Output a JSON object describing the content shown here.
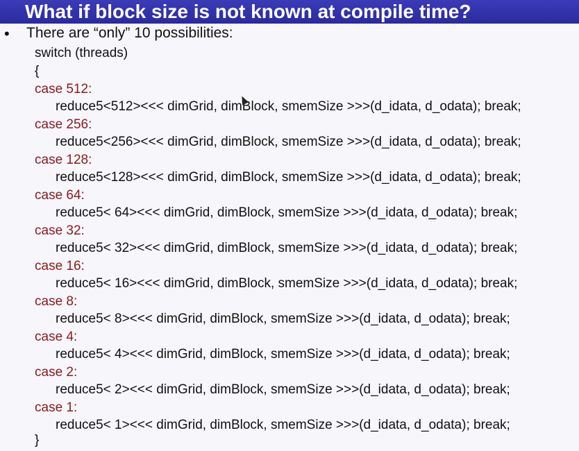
{
  "slide": {
    "title": "What if block size is not known at compile time?",
    "bullet_symbol": "•",
    "bullet_text": "There are “only” 10 possibilities:",
    "code": {
      "switch_line": "switch (threads)",
      "open_brace": "{",
      "close_brace": "}",
      "cases": [
        {
          "label": "case 512:",
          "call": "reduce5<512><<< dimGrid, dimBlock, smemSize >>>(d_idata, d_odata); break;"
        },
        {
          "label": "case 256:",
          "call": "reduce5<256><<< dimGrid, dimBlock, smemSize >>>(d_idata, d_odata); break;"
        },
        {
          "label": "case 128:",
          "call": "reduce5<128><<< dimGrid, dimBlock, smemSize >>>(d_idata, d_odata); break;"
        },
        {
          "label": "case 64:",
          "call": "reduce5< 64><<< dimGrid, dimBlock, smemSize >>>(d_idata, d_odata); break;"
        },
        {
          "label": "case 32:",
          "call": "reduce5< 32><<< dimGrid, dimBlock, smemSize >>>(d_idata, d_odata); break;"
        },
        {
          "label": "case 16:",
          "call": "reduce5< 16><<< dimGrid, dimBlock, smemSize >>>(d_idata, d_odata); break;"
        },
        {
          "label": "case 8:",
          "call": "reduce5< 8><<< dimGrid, dimBlock, smemSize >>>(d_idata, d_odata); break;"
        },
        {
          "label": "case 4:",
          "call": "reduce5< 4><<< dimGrid, dimBlock, smemSize >>>(d_idata, d_odata); break;"
        },
        {
          "label": "case 2:",
          "call": "reduce5< 2><<< dimGrid, dimBlock, smemSize >>>(d_idata, d_odata); break;"
        },
        {
          "label": "case 1:",
          "call": "reduce5< 1><<< dimGrid, dimBlock, smemSize >>>(d_idata, d_odata); break;"
        }
      ]
    }
  },
  "colors": {
    "title_bar": "#2f2fa8",
    "title_text": "#ffffff",
    "case_label": "#8b1a1a",
    "body_text": "#111111"
  }
}
